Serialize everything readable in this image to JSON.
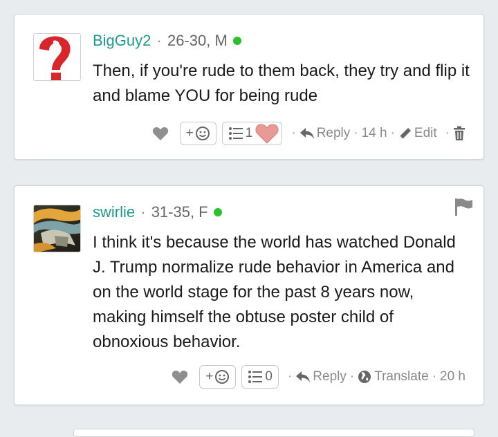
{
  "comments": [
    {
      "username": "BigGuy2",
      "meta": "26-30, M",
      "text": "Then, if you're rude to them back, they try and flip it and blame YOU for being rude",
      "pill_plus": "+",
      "list_count": "1",
      "reply_label": "Reply",
      "time": "14 h",
      "edit_label": "Edit",
      "avatar": "question-mark-avatar"
    },
    {
      "username": "swirlie",
      "meta": "31-35, F",
      "text": "I think it's because the world has watched Donald J. Trump normalize rude behavior in America and on the world stage for the past 8 years now, making himself the obtuse poster child of obnoxious behavior.",
      "pill_plus": "+",
      "list_count": "0",
      "reply_label": "Reply",
      "translate_label": "Translate",
      "time": "20 h",
      "avatar": "photo-avatar"
    }
  ],
  "colors": {
    "username": "#1d9b89",
    "online": "#2bc12b",
    "muted": "#8a8a8a",
    "background": "#e9ecef"
  }
}
